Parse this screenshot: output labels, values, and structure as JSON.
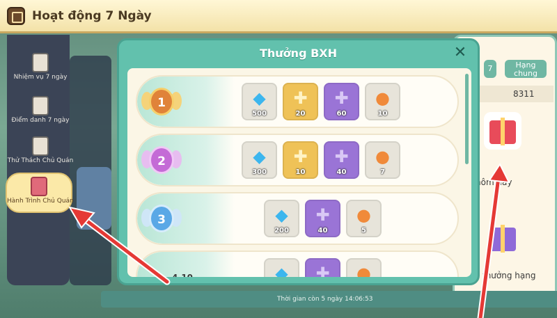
{
  "header": {
    "title": "Hoạt động 7 Ngày"
  },
  "sidebar": {
    "items": [
      {
        "label": "Nhiệm vụ 7 ngày",
        "active": false
      },
      {
        "label": "Điểm danh 7 ngày",
        "active": false
      },
      {
        "label": "Thử Thách Chủ Quán",
        "active": false
      },
      {
        "label": "Hành Trình Chủ Quán",
        "active": true
      }
    ]
  },
  "right_panel": {
    "tab_day": "7",
    "tab_rank": "Hạng chung",
    "rank_value": "8311",
    "gift1_label": "hôm nay",
    "gift2_label": "thưởng hạng"
  },
  "footer": {
    "timer": "Thời gian còn 5 ngày  14:06:53"
  },
  "modal": {
    "title": "Thưởng BXH",
    "close_icon": "close-icon",
    "ranks": [
      {
        "rank": "1",
        "medal_color": "#f0a94a",
        "rewards": [
          {
            "type": "diamond",
            "icon": "diamond-icon",
            "count": "500"
          },
          {
            "type": "gold",
            "icon": "gold-puzzle-icon",
            "count": "20"
          },
          {
            "type": "purple",
            "icon": "purple-puzzle-icon",
            "count": "60"
          },
          {
            "type": "coin",
            "icon": "coin-icon",
            "count": "10"
          }
        ]
      },
      {
        "rank": "2",
        "medal_color": "#c46bd6",
        "rewards": [
          {
            "type": "diamond",
            "icon": "diamond-icon",
            "count": "300"
          },
          {
            "type": "gold",
            "icon": "gold-puzzle-icon",
            "count": "10"
          },
          {
            "type": "purple",
            "icon": "purple-puzzle-icon",
            "count": "40"
          },
          {
            "type": "coin",
            "icon": "coin-icon",
            "count": "7"
          }
        ]
      },
      {
        "rank": "3",
        "medal_color": "#5aa8e6",
        "rewards": [
          {
            "type": "diamond",
            "icon": "diamond-icon",
            "count": "200"
          },
          {
            "type": "purple",
            "icon": "purple-puzzle-icon",
            "count": "40"
          },
          {
            "type": "coin",
            "icon": "coin-icon",
            "count": "5"
          }
        ]
      },
      {
        "rank_label": "4-10",
        "rewards": [
          {
            "type": "diamond",
            "icon": "diamond-icon",
            "count": ""
          },
          {
            "type": "purple",
            "icon": "purple-puzzle-icon",
            "count": ""
          },
          {
            "type": "coin",
            "icon": "coin-icon",
            "count": ""
          }
        ]
      }
    ]
  },
  "colors": {
    "accent": "#62c1ad",
    "annotation": "#e53935"
  }
}
